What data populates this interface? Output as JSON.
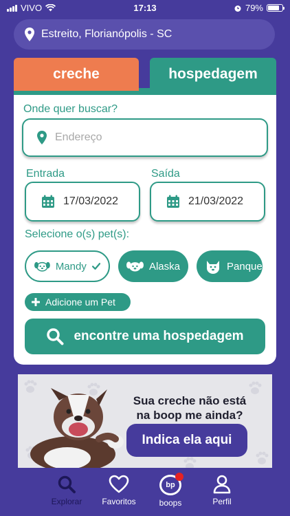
{
  "status": {
    "carrier": "VIVO",
    "time": "17:13",
    "battery": "79%"
  },
  "location": {
    "text": "Estreito, Florianópolis - SC"
  },
  "tabs": [
    {
      "label": "creche",
      "color": "#ee7c4f"
    },
    {
      "label": "hospedagem",
      "color": "#2e9a86",
      "active": true
    }
  ],
  "form": {
    "search_label": "Onde quer buscar?",
    "address_placeholder": "Endereço",
    "address_value": "",
    "entrada_label": "Entrada",
    "entrada_value": "17/03/2022",
    "saida_label": "Saída",
    "saida_value": "21/03/2022",
    "pets_label": "Selecione o(s) pet(s):",
    "pets": [
      {
        "name": "Mandy",
        "selected": true
      },
      {
        "name": "Alaska",
        "selected": false
      },
      {
        "name": "Panqueca",
        "selected": false
      }
    ],
    "add_pet_label": "Adicione um Pet",
    "search_button": "encontre uma hospedagem"
  },
  "banner": {
    "line1": "Sua creche não está",
    "line2": "na boop me ainda?",
    "cta": "Indica ela aqui"
  },
  "tabbar": [
    {
      "label": "Explorar",
      "icon": "search-icon",
      "active": true
    },
    {
      "label": "Favoritos",
      "icon": "heart-icon"
    },
    {
      "label": "boops",
      "icon": "boops-icon",
      "badge": true
    },
    {
      "label": "Perfil",
      "icon": "user-icon"
    }
  ],
  "colors": {
    "primary": "#463b9c",
    "accent": "#2e9a86",
    "orange": "#ee7c4f",
    "badge": "#e52222"
  }
}
